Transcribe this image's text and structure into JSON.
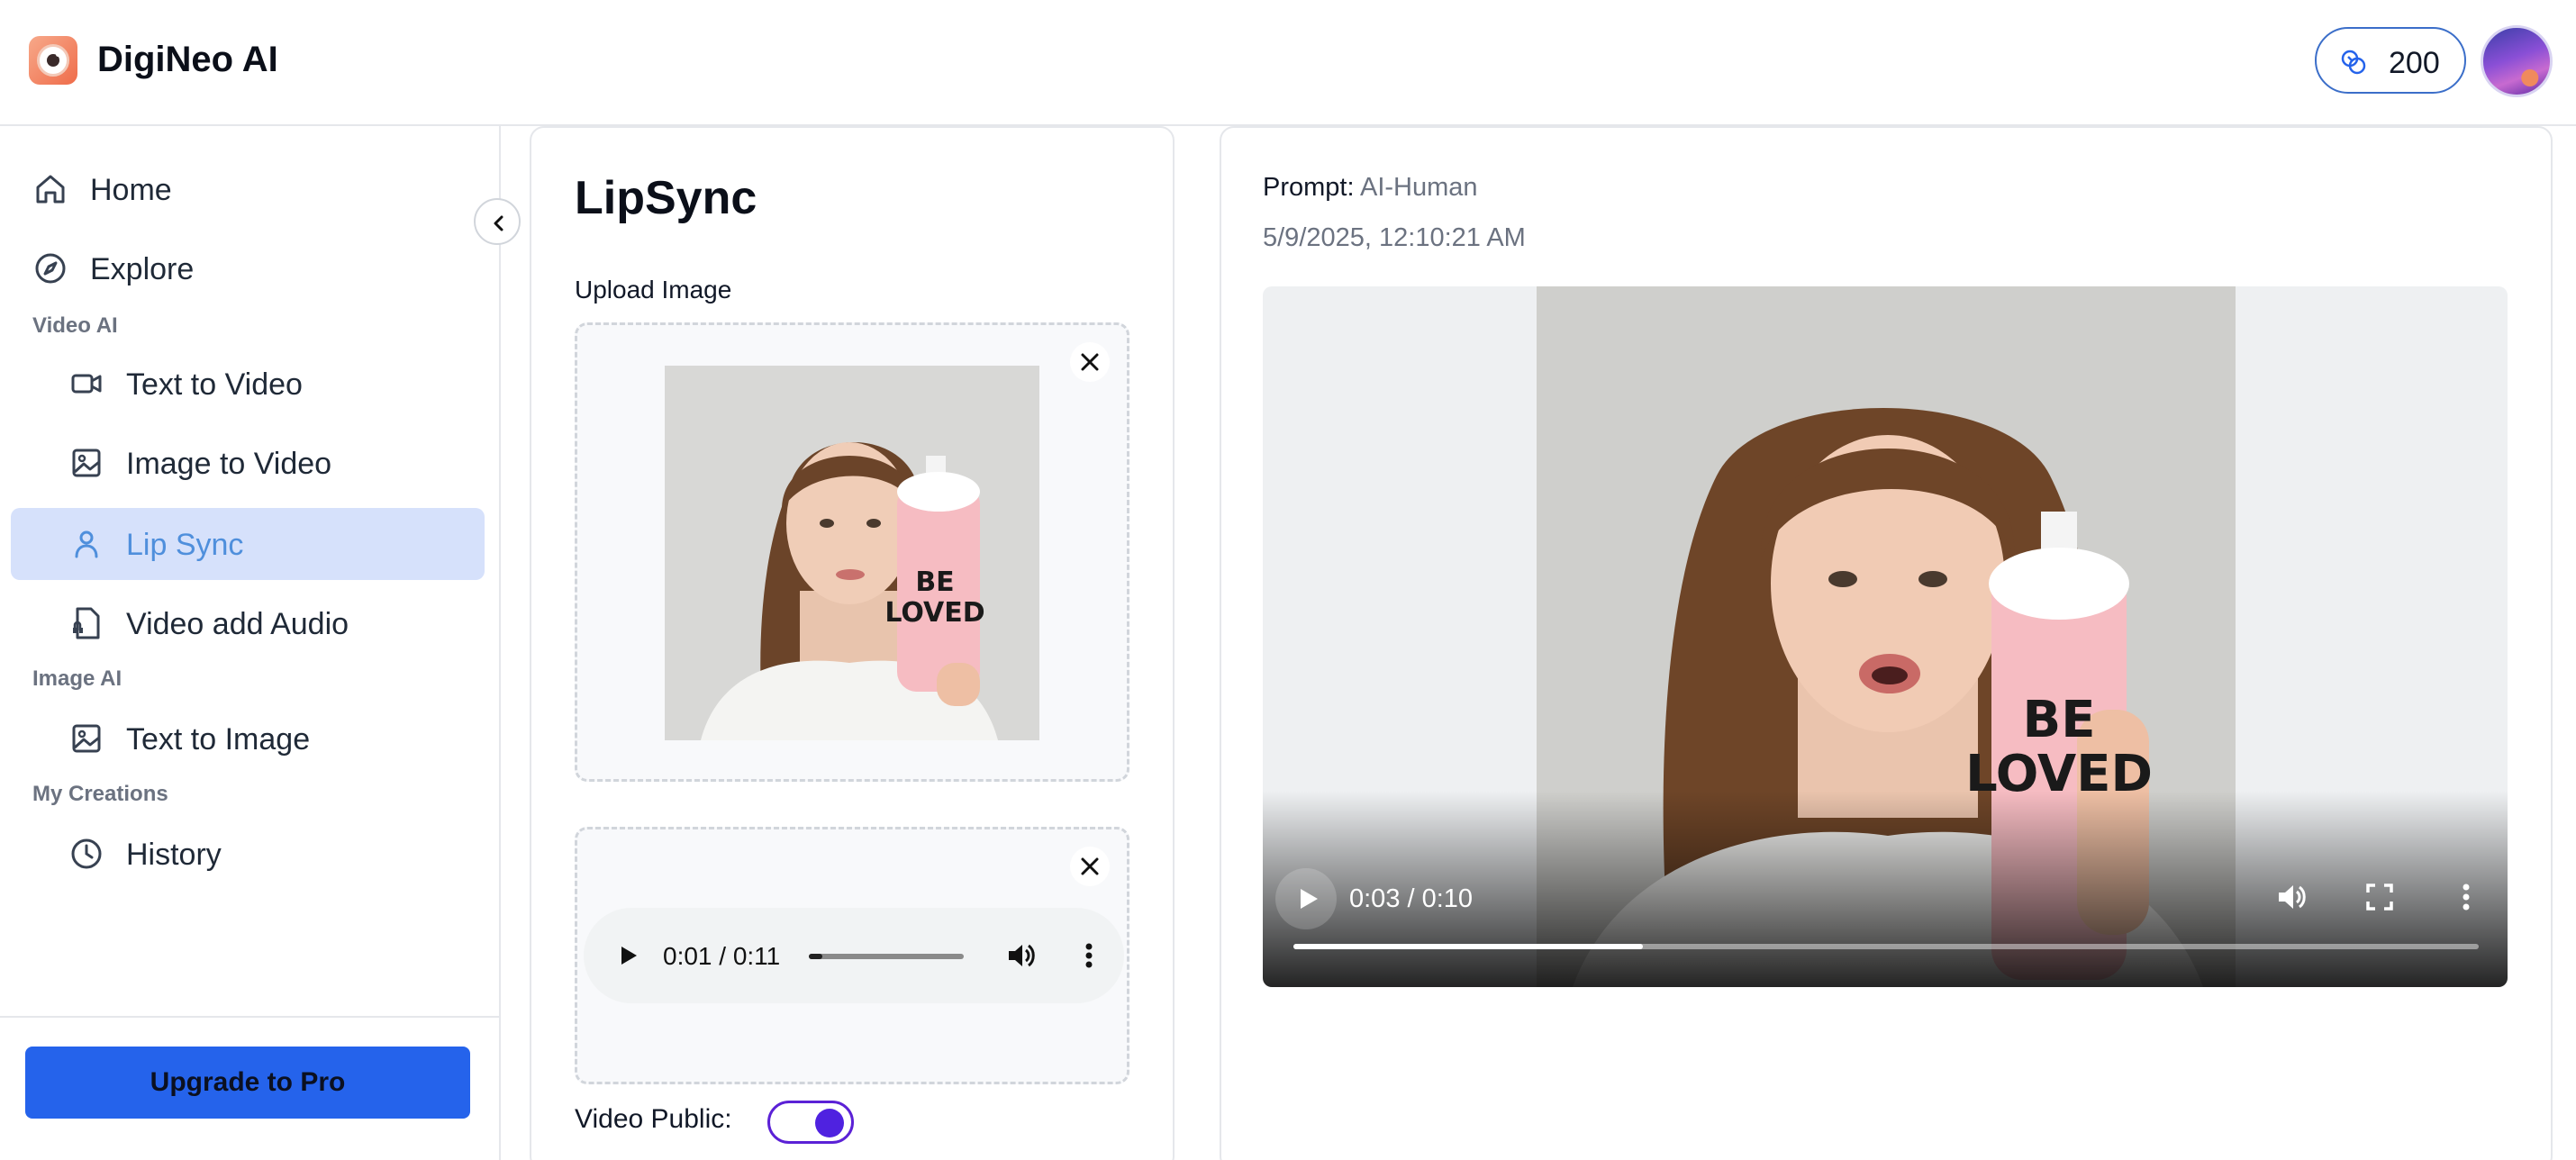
{
  "header": {
    "brand": "DigiNeo AI",
    "credits": "200"
  },
  "sidebar": {
    "home": "Home",
    "explore": "Explore",
    "section_video": "Video AI",
    "text_to_video": "Text to Video",
    "image_to_video": "Image to Video",
    "lip_sync": "Lip Sync",
    "video_add_audio": "Video add Audio",
    "section_image": "Image AI",
    "text_to_image": "Text to Image",
    "section_creations": "My Creations",
    "history": "History",
    "upgrade": "Upgrade to Pro",
    "active_item": "Lip Sync"
  },
  "form": {
    "title": "LipSync",
    "upload_label": "Upload Image",
    "audio_time": "0:01 / 0:11",
    "audio_progress": 0.09,
    "video_public_label": "Video Public:",
    "video_public": true,
    "bottle_text": [
      "BE",
      "LOVED"
    ]
  },
  "result": {
    "prompt_key": "Prompt:",
    "prompt_value": "AI-Human",
    "date": "5/9/2025, 12:10:21 AM",
    "video_time": "0:03 / 0:10",
    "video_progress": 0.295
  },
  "colors": {
    "accent": "#2563eb",
    "active_bg": "#d6e1fb",
    "active_text": "#4f8fdc",
    "toggle": "#4f22e0"
  }
}
